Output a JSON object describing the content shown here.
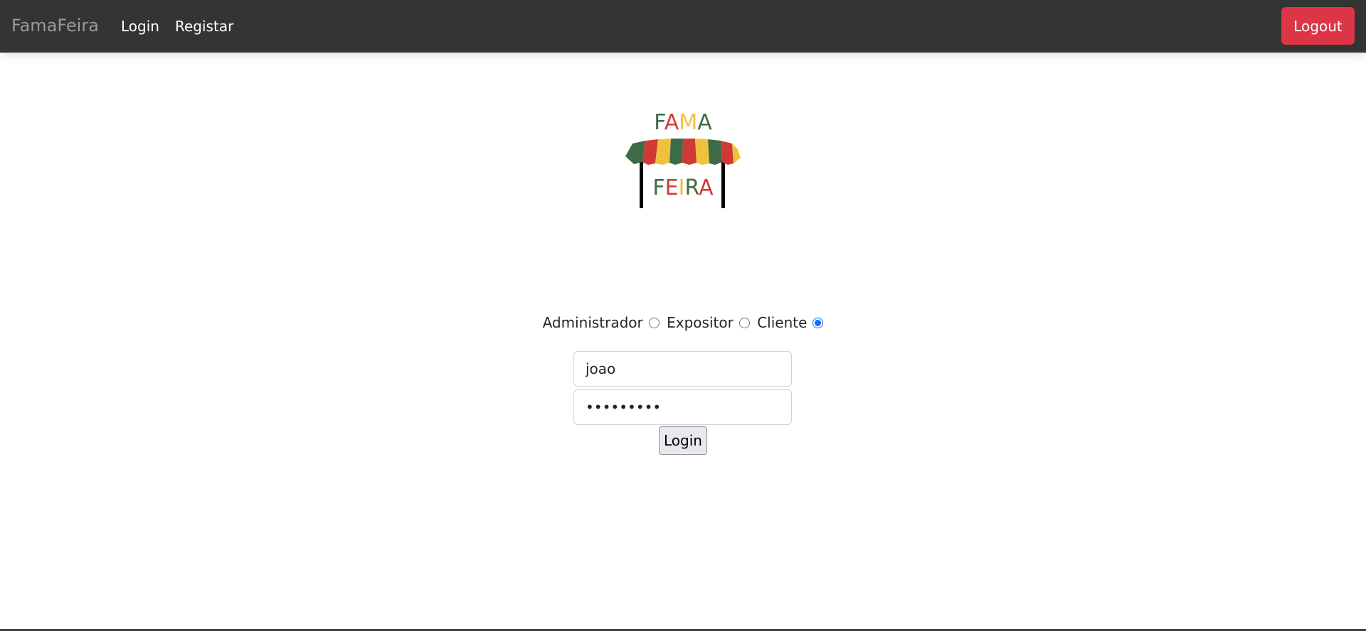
{
  "navbar": {
    "brand": "FamaFeira",
    "links": [
      "Login",
      "Registar"
    ],
    "logout_label": "Logout"
  },
  "logo": {
    "top_text": "FAMA",
    "bottom_text": "FEIRA",
    "colors": {
      "green": "#3e6b47",
      "red": "#d03a36",
      "yellow": "#f0c23c"
    }
  },
  "login_form": {
    "roles": [
      {
        "label": "Administrador",
        "checked": false
      },
      {
        "label": "Expositor",
        "checked": false
      },
      {
        "label": "Cliente",
        "checked": true
      }
    ],
    "username_value": "joao",
    "password_value": "jjjjjjjjj",
    "submit_label": "Login"
  }
}
